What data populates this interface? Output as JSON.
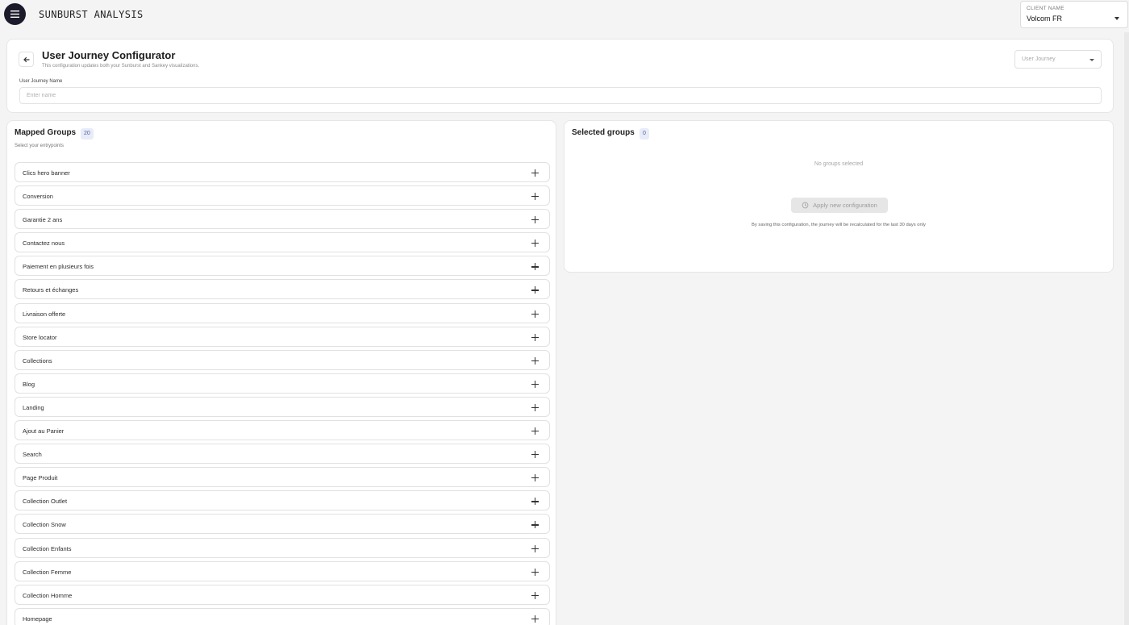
{
  "app": {
    "title": "SUNBURST ANALYSIS"
  },
  "client": {
    "label": "CLIENT NAME",
    "value": "Volcom FR"
  },
  "configurator": {
    "title": "User Journey Configurator",
    "subtitle": "This configuration updates both your Sunburst and Sankey visualizations.",
    "journey_select_placeholder": "User Journey",
    "name_label": "User Journey Name",
    "name_placeholder": "Enter name",
    "name_value": ""
  },
  "mapped": {
    "title": "Mapped Groups",
    "count": "20",
    "subtitle": "Select your entrypoints",
    "groups": [
      "Clics hero banner",
      "Conversion",
      "Garantie 2 ans",
      "Contactez nous",
      "Paiement en plusieurs fois",
      "Retours et échanges",
      "Livraison offerte",
      "Store locator",
      "Collections",
      "Blog",
      "Landing",
      "Ajout au Panier",
      "Search",
      "Page Produit",
      "Collection Outlet",
      "Collection Snow",
      "Collection Enfants",
      "Collection Femme",
      "Collection Homme",
      "Homepage"
    ]
  },
  "selected": {
    "title": "Selected groups",
    "count": "0",
    "empty_text": "No groups selected",
    "apply_label": "Apply new configuration",
    "note": "By saving this configuration, the journey will be recalculated for the last 30 days only"
  },
  "icons": {
    "menu": "menu-icon",
    "back": "arrow-left-icon",
    "add": "plus-icon",
    "apply": "history-icon",
    "dropdown": "caret-down-icon"
  }
}
